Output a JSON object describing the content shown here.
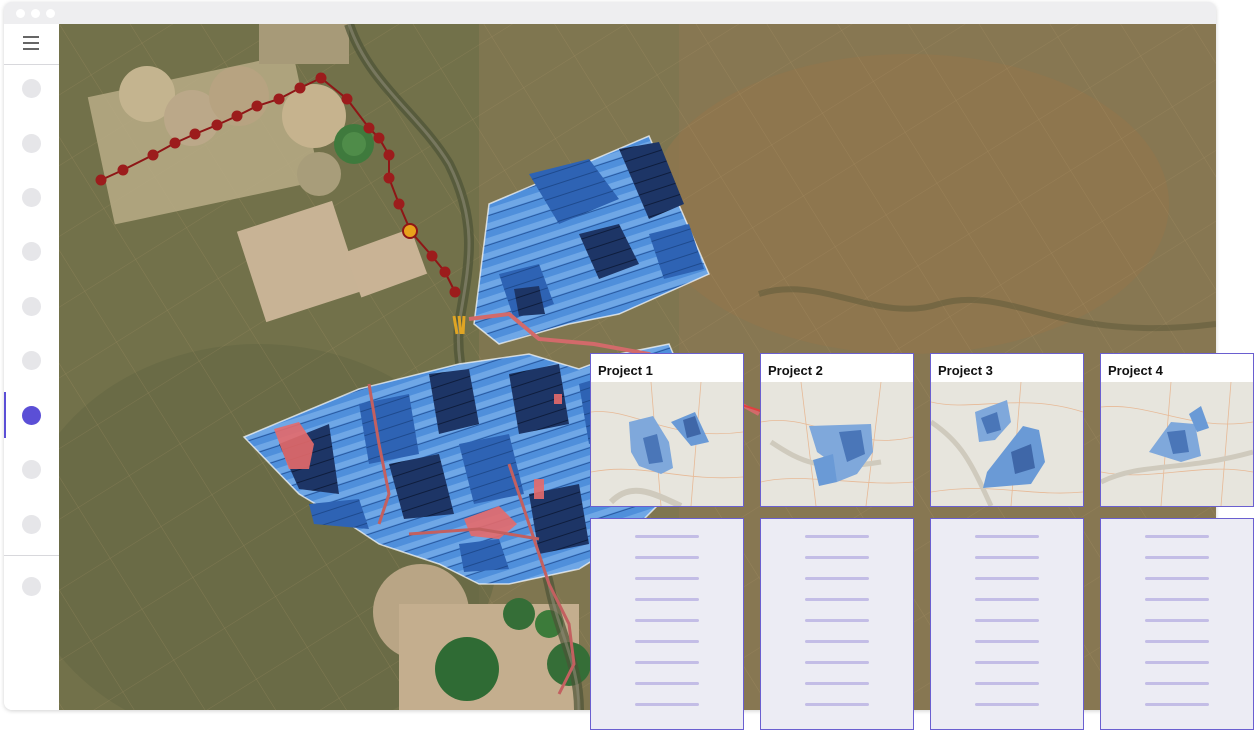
{
  "sidebar": {
    "menu_icon": "hamburger-menu-icon",
    "nav_items": 10,
    "active_index": 6,
    "active_color": "#5b4fd6"
  },
  "map": {
    "imagery": "satellite",
    "panel_color": "#3d7fd0",
    "exclusion_color": "#e65a5a",
    "route_color": "#9a1c1c"
  },
  "projects": [
    {
      "title": "Project 1"
    },
    {
      "title": "Project 2"
    },
    {
      "title": "Project 3"
    },
    {
      "title": "Project 4"
    }
  ]
}
